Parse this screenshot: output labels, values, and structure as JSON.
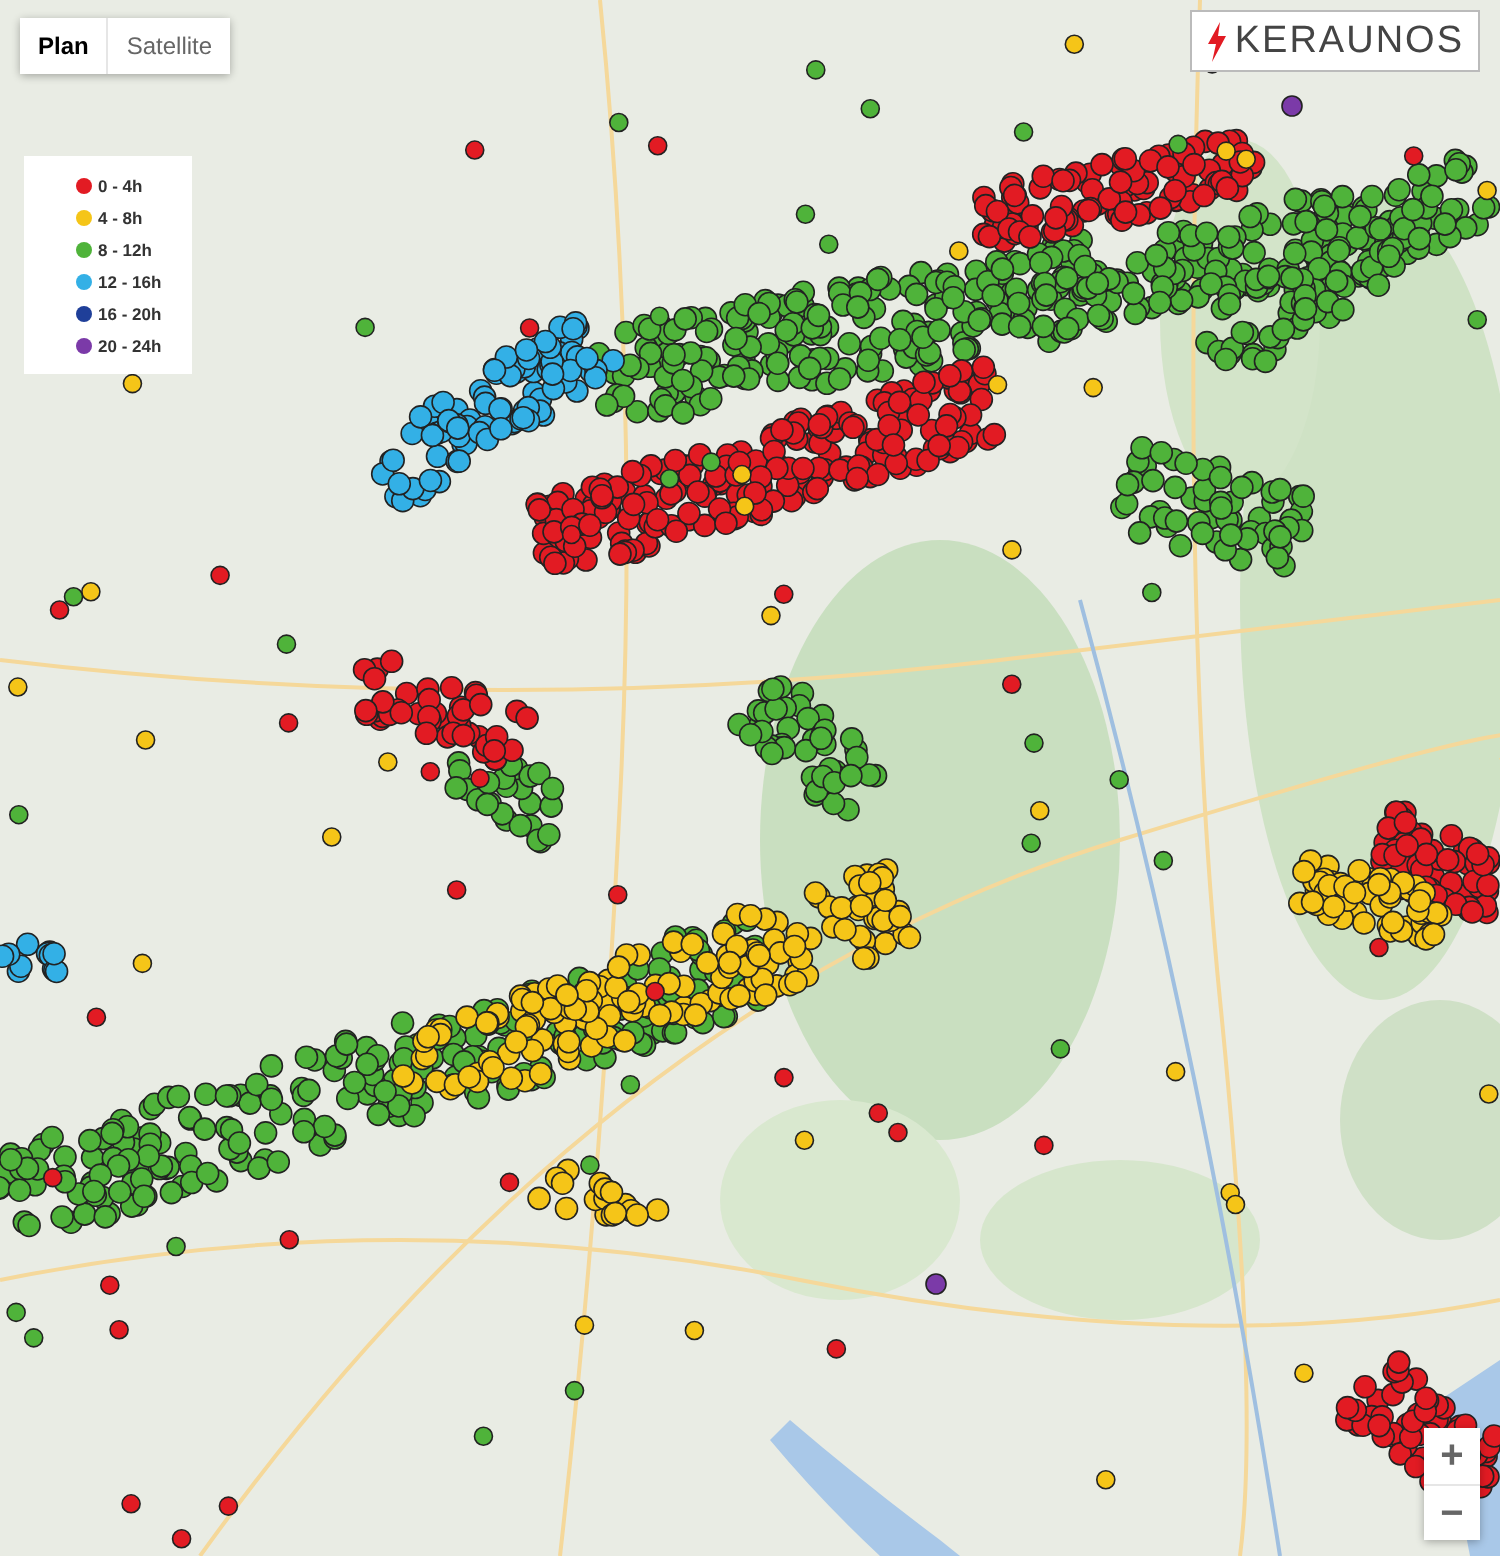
{
  "map_type_tabs": [
    {
      "label": "Plan",
      "selected": true
    },
    {
      "label": "Satellite",
      "selected": false
    }
  ],
  "legend": [
    {
      "label": "0 - 4h",
      "color": "#e21b23"
    },
    {
      "label": "4 - 8h",
      "color": "#f5c518"
    },
    {
      "label": "8 - 12h",
      "color": "#4fb33a"
    },
    {
      "label": "12 - 16h",
      "color": "#33b0e6"
    },
    {
      "label": "16 - 20h",
      "color": "#1f3f99"
    },
    {
      "label": "20 - 24h",
      "color": "#7b3aa8"
    }
  ],
  "logo": {
    "text": "KERAUNOS"
  },
  "zoom_controls": [
    "+",
    "−"
  ]
}
